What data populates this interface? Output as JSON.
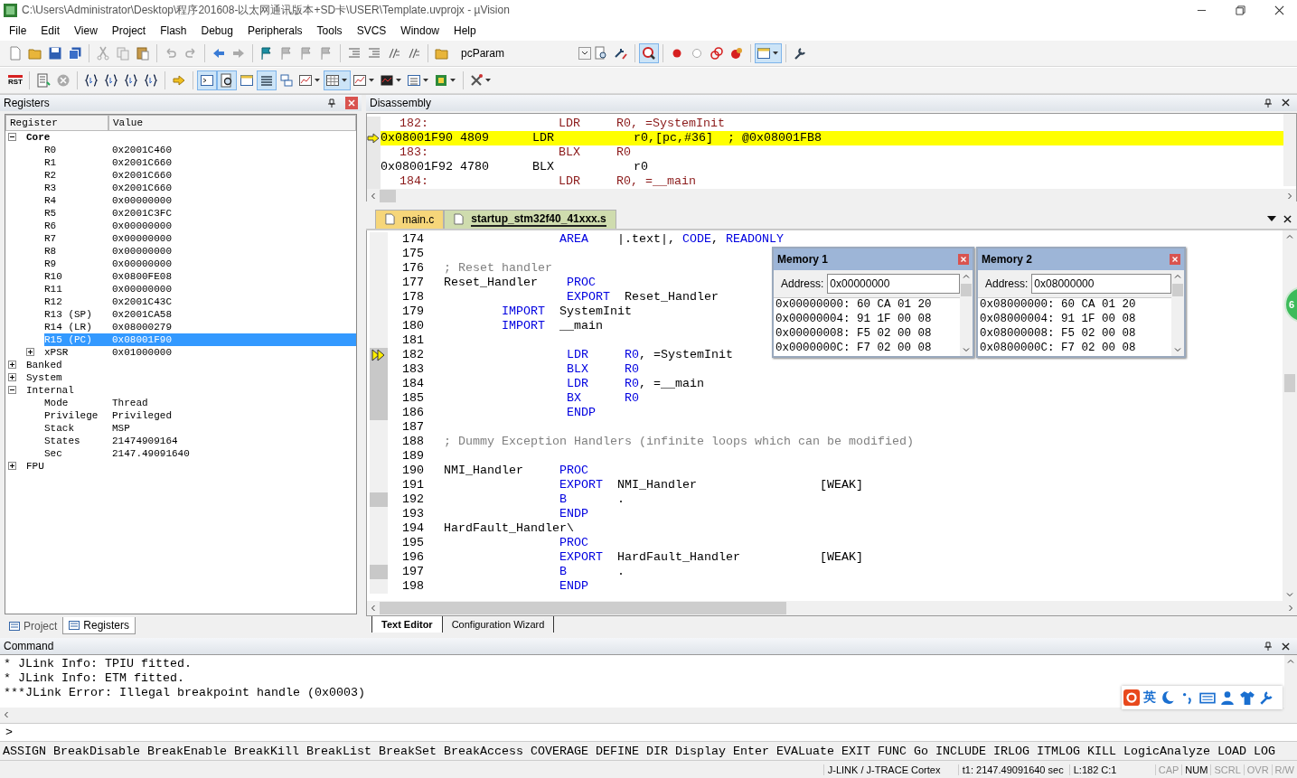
{
  "window": {
    "title": "C:\\Users\\Administrator\\Desktop\\程序201608-以太网通讯版本+SD卡\\USER\\Template.uvprojx - µVision"
  },
  "menu": [
    "File",
    "Edit",
    "View",
    "Project",
    "Flash",
    "Debug",
    "Peripherals",
    "Tools",
    "SVCS",
    "Window",
    "Help"
  ],
  "toolbars": [
    {
      "items": [
        {
          "kind": "button",
          "on": false
        },
        {
          "kind": "button",
          "on": false
        },
        {
          "kind": "button",
          "on": false
        },
        {
          "kind": "button",
          "on": false
        },
        {
          "kind": "separator"
        },
        {
          "kind": "button",
          "on": false
        },
        {
          "kind": "button",
          "on": false
        },
        {
          "kind": "button",
          "on": false
        },
        {
          "kind": "separator"
        },
        {
          "kind": "button",
          "on": false
        },
        {
          "kind": "button",
          "on": false
        },
        {
          "kind": "separator"
        },
        {
          "kind": "button",
          "on": false
        },
        {
          "kind": "button",
          "on": false
        },
        {
          "kind": "separator"
        },
        {
          "kind": "button",
          "on": false
        },
        {
          "kind": "button",
          "on": false
        },
        {
          "kind": "button",
          "on": false
        },
        {
          "kind": "button",
          "on": false
        },
        {
          "kind": "separator"
        },
        {
          "kind": "button",
          "on": false
        },
        {
          "kind": "button",
          "on": false
        },
        {
          "kind": "button",
          "on": false
        },
        {
          "kind": "button",
          "on": false
        },
        {
          "kind": "separator"
        },
        {
          "kind": "button",
          "on": false
        },
        {
          "kind": "combo",
          "value": "pcParam"
        },
        {
          "kind": "button",
          "on": false
        },
        {
          "kind": "button",
          "on": false
        },
        {
          "kind": "separator"
        },
        {
          "kind": "button",
          "on": true
        },
        {
          "kind": "separator"
        },
        {
          "kind": "button",
          "on": false
        },
        {
          "kind": "button",
          "on": false
        },
        {
          "kind": "button",
          "on": false
        },
        {
          "kind": "button",
          "on": false
        },
        {
          "kind": "separator"
        },
        {
          "kind": "button",
          "on": true
        },
        {
          "kind": "separator"
        },
        {
          "kind": "button",
          "on": false
        }
      ]
    },
    {
      "items": [
        {
          "kind": "button",
          "on": false,
          "label": "RST"
        },
        {
          "kind": "separator"
        },
        {
          "kind": "button",
          "on": false
        },
        {
          "kind": "button",
          "on": false
        },
        {
          "kind": "separator"
        },
        {
          "kind": "button",
          "on": false
        },
        {
          "kind": "button",
          "on": false
        },
        {
          "kind": "button",
          "on": false
        },
        {
          "kind": "button",
          "on": false
        },
        {
          "kind": "separator"
        },
        {
          "kind": "button",
          "on": false
        },
        {
          "kind": "separator"
        },
        {
          "kind": "button",
          "on": true
        },
        {
          "kind": "button",
          "on": true
        },
        {
          "kind": "button",
          "on": false
        },
        {
          "kind": "button",
          "on": true
        },
        {
          "kind": "button",
          "on": false
        },
        {
          "kind": "button",
          "on": false
        },
        {
          "kind": "button",
          "on": true
        },
        {
          "kind": "button",
          "on": false
        },
        {
          "kind": "button",
          "on": false
        },
        {
          "kind": "button",
          "on": false
        },
        {
          "kind": "button",
          "on": false
        },
        {
          "kind": "separator"
        },
        {
          "kind": "button",
          "on": false
        }
      ]
    }
  ],
  "registers": {
    "title": "Registers",
    "columns": [
      "Register",
      "Value"
    ],
    "tree": [
      {
        "name": "Core",
        "bold": true,
        "expanded": true,
        "selected": false,
        "children": [
          {
            "name": "R0",
            "value": "0x2001C460",
            "selected": false
          },
          {
            "name": "R1",
            "value": "0x2001C660",
            "selected": false
          },
          {
            "name": "R2",
            "value": "0x2001C660",
            "selected": false
          },
          {
            "name": "R3",
            "value": "0x2001C660",
            "selected": false
          },
          {
            "name": "R4",
            "value": "0x00000000",
            "selected": false
          },
          {
            "name": "R5",
            "value": "0x2001C3FC",
            "selected": false
          },
          {
            "name": "R6",
            "value": "0x00000000",
            "selected": false
          },
          {
            "name": "R7",
            "value": "0x00000000",
            "selected": false
          },
          {
            "name": "R8",
            "value": "0x00000000",
            "selected": false
          },
          {
            "name": "R9",
            "value": "0x00000000",
            "selected": false
          },
          {
            "name": "R10",
            "value": "0x0800FE08",
            "selected": false
          },
          {
            "name": "R11",
            "value": "0x00000000",
            "selected": false
          },
          {
            "name": "R12",
            "value": "0x2001C43C",
            "selected": false
          },
          {
            "name": "R13 (SP)",
            "value": "0x2001CA58",
            "selected": false
          },
          {
            "name": "R14 (LR)",
            "value": "0x08000279",
            "selected": false
          },
          {
            "name": "R15 (PC)",
            "value": "0x08001F90",
            "selected": true
          },
          {
            "name": "xPSR",
            "value": "0x01000000",
            "expanded": false,
            "selected": false
          }
        ]
      },
      {
        "name": "Banked",
        "bold": false,
        "expanded": false,
        "selected": false
      },
      {
        "name": "System",
        "bold": false,
        "expanded": false,
        "selected": false
      },
      {
        "name": "Internal",
        "bold": false,
        "expanded": true,
        "selected": false,
        "children": [
          {
            "name": "Mode",
            "value": "Thread",
            "selected": false
          },
          {
            "name": "Privilege",
            "value": "Privileged",
            "selected": false
          },
          {
            "name": "Stack",
            "value": "MSP",
            "selected": false
          },
          {
            "name": "States",
            "value": "21474909164",
            "selected": false
          },
          {
            "name": "Sec",
            "value": "2147.49091640",
            "selected": false
          }
        ]
      },
      {
        "name": "FPU",
        "bold": false,
        "expanded": false,
        "selected": false
      }
    ]
  },
  "left_tabs": [
    {
      "label": "Project",
      "selected": false
    },
    {
      "label": "Registers",
      "selected": true
    }
  ],
  "disassembly": {
    "title": "Disassembly",
    "rows": [
      {
        "kind": "source",
        "text": "182:                  LDR     R0, =SystemInit",
        "current": false
      },
      {
        "kind": "asm",
        "text": "0x08001F90 4809      LDR           r0,[pc,#36]  ; @0x08001FB8",
        "current": true
      },
      {
        "kind": "source",
        "text": "183:                  BLX     R0",
        "current": false
      },
      {
        "kind": "asm",
        "text": "0x08001F92 4780      BLX           r0",
        "current": false
      },
      {
        "kind": "source",
        "text": "184:                  LDR     R0, =__main",
        "current": false
      }
    ]
  },
  "editor_tabs": [
    {
      "label": "main.c",
      "selected": false
    },
    {
      "label": "startup_stm32f40_41xxx.s",
      "selected": true
    }
  ],
  "editor": {
    "lines": [
      {
        "num": "174",
        "executable": false,
        "current": false,
        "code": [
          {
            "kind": "keyword",
            "text": "                AREA"
          },
          {
            "kind": "plain",
            "text": "    |.text|, "
          },
          {
            "kind": "keyword",
            "text": "CODE"
          },
          {
            "kind": "plain",
            "text": ", "
          },
          {
            "kind": "keyword",
            "text": "READONLY"
          }
        ]
      },
      {
        "num": "175",
        "executable": false,
        "current": false
      },
      {
        "num": "176",
        "executable": false,
        "current": false,
        "code": [
          {
            "kind": "comment",
            "text": "; Reset handler"
          }
        ]
      },
      {
        "num": "177",
        "executable": false,
        "current": false,
        "code": [
          {
            "kind": "plain",
            "text": "Reset_Handler"
          },
          {
            "kind": "keyword",
            "text": "    PROC"
          }
        ]
      },
      {
        "num": "178",
        "executable": false,
        "current": false,
        "code": [
          {
            "kind": "keyword",
            "text": "                 EXPORT"
          },
          {
            "kind": "plain",
            "text": "  Reset_Handler"
          }
        ]
      },
      {
        "num": "179",
        "executable": false,
        "current": false,
        "code": [
          {
            "kind": "keyword",
            "text": "        IMPORT"
          },
          {
            "kind": "plain",
            "text": "  SystemInit"
          }
        ]
      },
      {
        "num": "180",
        "executable": false,
        "current": false,
        "code": [
          {
            "kind": "keyword",
            "text": "        IMPORT"
          },
          {
            "kind": "plain",
            "text": "  __main"
          }
        ]
      },
      {
        "num": "181",
        "executable": false,
        "current": false
      },
      {
        "num": "182",
        "executable": true,
        "current": true,
        "code": [
          {
            "kind": "keyword",
            "text": "                 LDR"
          },
          {
            "kind": "keyword",
            "text": "     R0"
          },
          {
            "kind": "plain",
            "text": ", =SystemInit"
          }
        ]
      },
      {
        "num": "183",
        "executable": true,
        "current": false,
        "code": [
          {
            "kind": "keyword",
            "text": "                 BLX"
          },
          {
            "kind": "keyword",
            "text": "     R0"
          }
        ]
      },
      {
        "num": "184",
        "executable": true,
        "current": false,
        "code": [
          {
            "kind": "keyword",
            "text": "                 LDR"
          },
          {
            "kind": "keyword",
            "text": "     R0"
          },
          {
            "kind": "plain",
            "text": ", =__main"
          }
        ]
      },
      {
        "num": "185",
        "executable": true,
        "current": false,
        "code": [
          {
            "kind": "keyword",
            "text": "                 BX"
          },
          {
            "kind": "keyword",
            "text": "      R0"
          }
        ]
      },
      {
        "num": "186",
        "executable": true,
        "current": false,
        "code": [
          {
            "kind": "keyword",
            "text": "                 ENDP"
          }
        ]
      },
      {
        "num": "187",
        "executable": false,
        "current": false
      },
      {
        "num": "188",
        "executable": false,
        "current": false,
        "code": [
          {
            "kind": "comment",
            "text": "; Dummy Exception Handlers (infinite loops which can be modified)"
          }
        ]
      },
      {
        "num": "189",
        "executable": false,
        "current": false
      },
      {
        "num": "190",
        "executable": false,
        "current": false,
        "code": [
          {
            "kind": "plain",
            "text": "NMI_Handler"
          },
          {
            "kind": "keyword",
            "text": "     PROC"
          }
        ]
      },
      {
        "num": "191",
        "executable": false,
        "current": false,
        "code": [
          {
            "kind": "keyword",
            "text": "                EXPORT"
          },
          {
            "kind": "plain",
            "text": "  NMI_Handler                 [WEAK]"
          }
        ]
      },
      {
        "num": "192",
        "executable": true,
        "current": false,
        "code": [
          {
            "kind": "keyword",
            "text": "                B"
          },
          {
            "kind": "plain",
            "text": "       ."
          }
        ]
      },
      {
        "num": "193",
        "executable": false,
        "current": false,
        "code": [
          {
            "kind": "keyword",
            "text": "                ENDP"
          }
        ]
      },
      {
        "num": "194",
        "executable": false,
        "current": false,
        "code": [
          {
            "kind": "plain",
            "text": "HardFault_Handler\\"
          }
        ]
      },
      {
        "num": "195",
        "executable": false,
        "current": false,
        "code": [
          {
            "kind": "keyword",
            "text": "                PROC"
          }
        ]
      },
      {
        "num": "196",
        "executable": false,
        "current": false,
        "code": [
          {
            "kind": "keyword",
            "text": "                EXPORT"
          },
          {
            "kind": "plain",
            "text": "  HardFault_Handler           [WEAK]"
          }
        ]
      },
      {
        "num": "197",
        "executable": true,
        "current": false,
        "code": [
          {
            "kind": "keyword",
            "text": "                B"
          },
          {
            "kind": "plain",
            "text": "       ."
          }
        ]
      },
      {
        "num": "198",
        "executable": false,
        "current": false,
        "code": [
          {
            "kind": "keyword",
            "text": "                ENDP"
          }
        ]
      }
    ]
  },
  "memory_windows": [
    {
      "title": "Memory 1",
      "address_label": "Address:",
      "address": "0x00000000",
      "rows": [
        "0x00000000: 60 CA 01 20",
        "0x00000004: 91 1F 00 08",
        "0x00000008: F5 02 00 08",
        "0x0000000C: F7 02 00 08"
      ]
    },
    {
      "title": "Memory 2",
      "address_label": "Address:",
      "address": "0x08000000",
      "rows": [
        "0x08000000: 60 CA 01 20",
        "0x08000004: 91 1F 00 08",
        "0x08000008: F5 02 00 08",
        "0x0800000C: F7 02 00 08"
      ]
    }
  ],
  "floating_badge": "6",
  "editor_bottom_tabs": [
    {
      "label": "Text Editor",
      "selected": true
    },
    {
      "label": "Configuration Wizard",
      "selected": false
    }
  ],
  "command": {
    "title": "Command",
    "output": [
      "* JLink Info: TPIU fitted.",
      "* JLink Info: ETM fitted.",
      "***JLink Error: Illegal breakpoint handle (0x0003)"
    ],
    "prompt": ">",
    "hints": [
      "ASSIGN",
      "BreakDisable",
      "BreakEnable",
      "BreakKill",
      "BreakList",
      "BreakSet",
      "BreakAccess",
      "COVERAGE",
      "DEFINE",
      "DIR",
      "Display",
      "Enter",
      "EVALuate",
      "EXIT",
      "FUNC",
      "Go",
      "INCLUDE",
      "IRLOG",
      "ITMLOG",
      "KILL",
      "LogicAnalyze",
      "LOAD",
      "LOG"
    ]
  },
  "ime_bar": {
    "language": "英"
  },
  "status_bar": {
    "target": "J-LINK / J-TRACE Cortex",
    "time": "t1: 2147.49091640 sec",
    "position": "L:182 C:1",
    "indicators": [
      {
        "label": "CAP",
        "on": false
      },
      {
        "label": "NUM",
        "on": true
      },
      {
        "label": "SCRL",
        "on": false
      },
      {
        "label": "OVR",
        "on": false
      },
      {
        "label": "R/W",
        "on": false
      }
    ]
  }
}
